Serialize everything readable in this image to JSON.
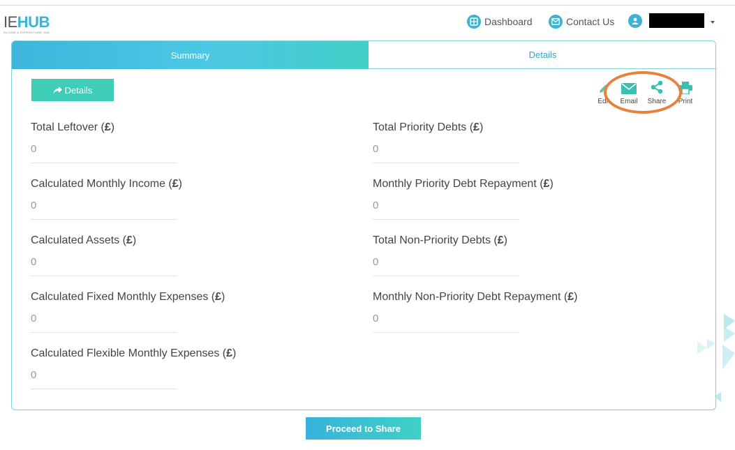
{
  "header": {
    "logo_ie": "IE",
    "logo_hub": "HUB",
    "logo_subtitle": "INCOME & EXPENDITURE HUB",
    "nav": [
      {
        "label": "Dashboard",
        "icon": "dashboard-icon"
      },
      {
        "label": "Contact Us",
        "icon": "mail-icon"
      }
    ],
    "user_icon": "user-icon"
  },
  "tabs": {
    "summary": "Summary",
    "details": "Details"
  },
  "toolbar": {
    "details_button": "Details",
    "edit": "Edit",
    "email": "Email",
    "share": "Share",
    "print": "Print"
  },
  "fields_left": [
    {
      "label": "Total Leftover (",
      "unit": "£",
      "value": "0"
    },
    {
      "label": "Calculated Monthly Income (",
      "unit": "£",
      "value": "0"
    },
    {
      "label": "Calculated Assets (",
      "unit": "£",
      "value": "0"
    },
    {
      "label": "Calculated Fixed Monthly Expenses (",
      "unit": "£",
      "value": "0"
    },
    {
      "label": "Calculated Flexible Monthly Expenses (",
      "unit": "£",
      "value": "0"
    }
  ],
  "fields_right": [
    {
      "label": "Total Priority Debts (",
      "unit": "£",
      "value": "0"
    },
    {
      "label": "Monthly Priority Debt Repayment (",
      "unit": "£",
      "value": "0"
    },
    {
      "label": "Total Non-Priority Debts (",
      "unit": "£",
      "value": "0"
    },
    {
      "label": "Monthly Non-Priority Debt Repayment (",
      "unit": "£",
      "value": "0"
    }
  ],
  "label_close": ")",
  "proceed_button": "Proceed to Share",
  "colors": {
    "accent_blue": "#3bb3d4",
    "accent_teal": "#40cdb7",
    "highlight_orange": "#e8813c"
  }
}
